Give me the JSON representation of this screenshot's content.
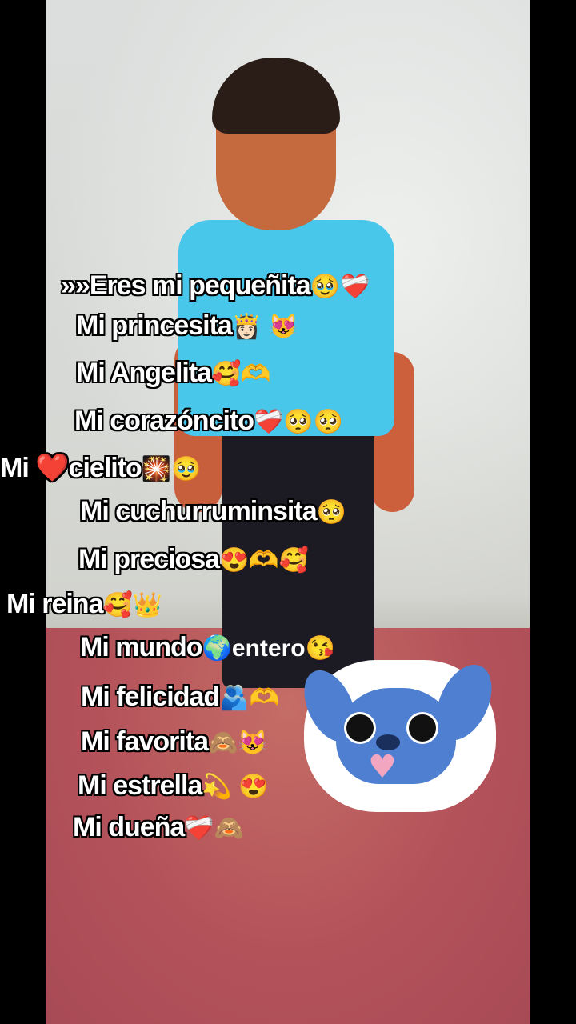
{
  "captions": [
    {
      "text": "»»Eres mi pequeñita",
      "emoji": "🥹❤️‍🩹"
    },
    {
      "text": "Mi princesita",
      "emoji": "👸🏻 😻"
    },
    {
      "text": "Mi Angelita",
      "emoji": "🥰🫶"
    },
    {
      "text": "Mi corazóncito",
      "emoji": "❤️‍🩹🥺🥺"
    },
    {
      "text": "Mi ❤️cielito",
      "emoji": "🎇🥹"
    },
    {
      "text": "Mi cuchurruminsita",
      "emoji": "🥺"
    },
    {
      "text": "Mi preciosa",
      "emoji": "😍🫶🥰"
    },
    {
      "text": "Mi reina",
      "emoji": "🥰👑"
    },
    {
      "text": "Mi mundo",
      "emoji": "🌍entero😘"
    },
    {
      "text": "Mi felicidad",
      "emoji": "🫂🫶"
    },
    {
      "text": "Mi favorita",
      "emoji": "🙈😻"
    },
    {
      "text": "Mi estrella",
      "emoji": "💫 😍"
    },
    {
      "text": "Mi dueña",
      "emoji": "❤️‍🩹🙈"
    }
  ]
}
